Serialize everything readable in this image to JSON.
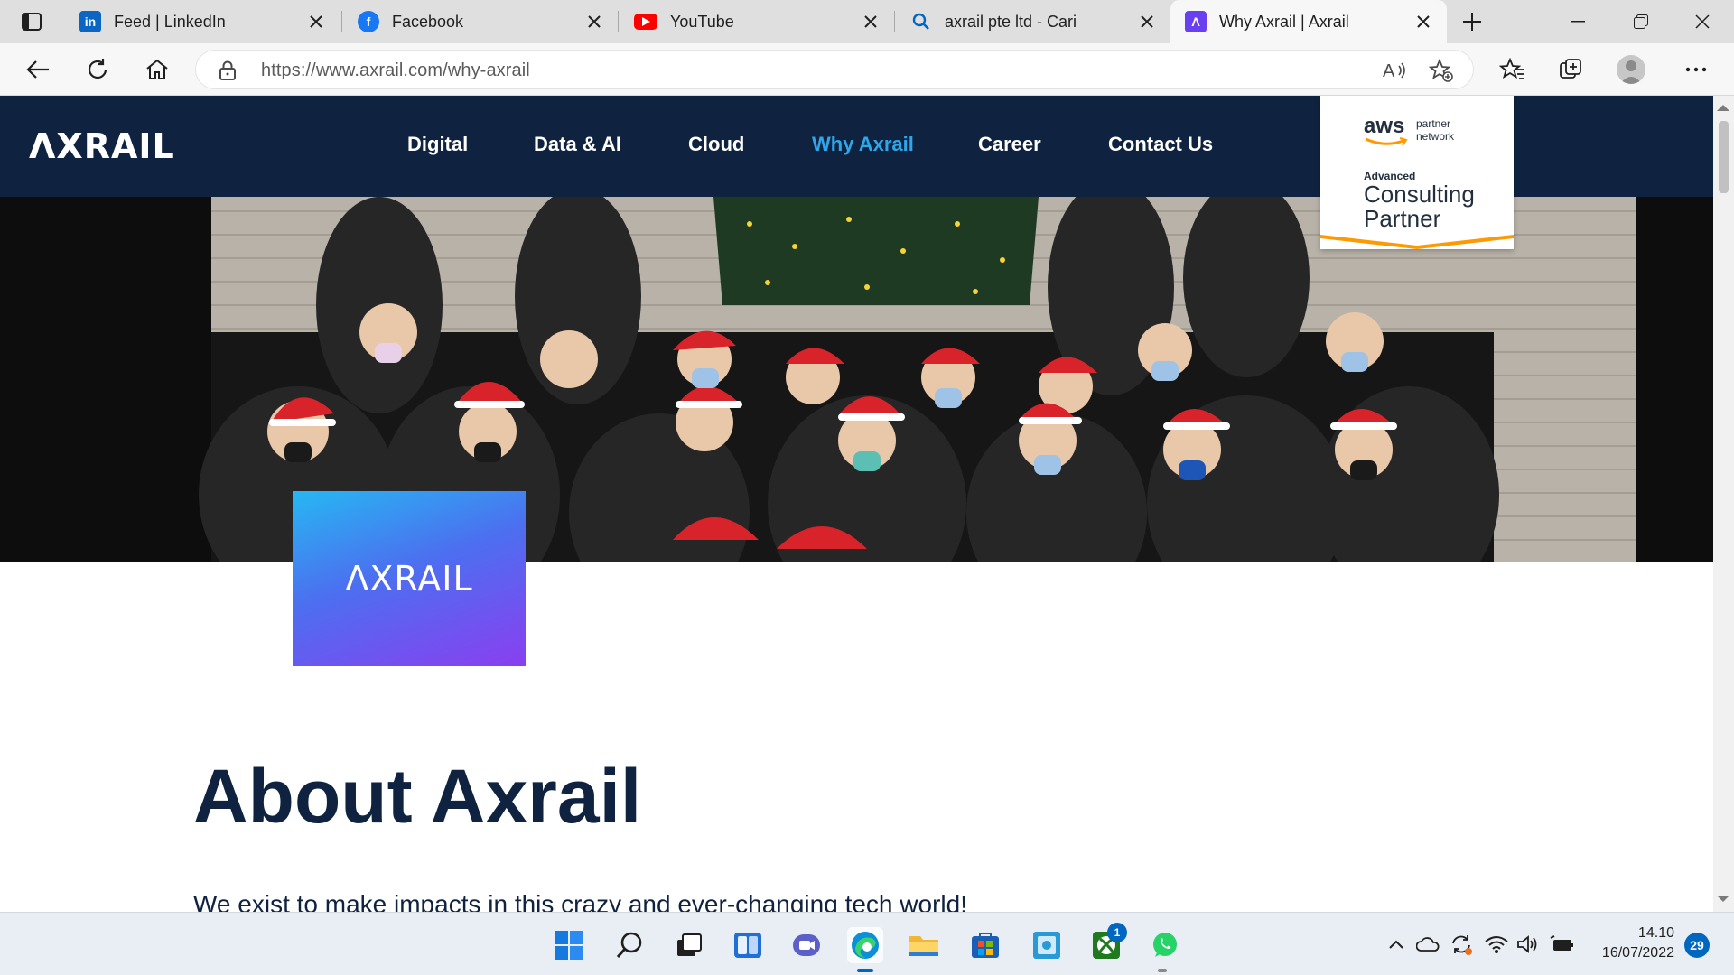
{
  "browser": {
    "tabs": [
      {
        "title": "Feed | LinkedIn",
        "favicon": "linkedin-icon",
        "color": "#0a66c2"
      },
      {
        "title": "Facebook",
        "favicon": "facebook-icon",
        "color": "#1877f2"
      },
      {
        "title": "YouTube",
        "favicon": "youtube-icon",
        "color": "#ff0000"
      },
      {
        "title": "axrail pte ltd - Cari",
        "favicon": "search-icon",
        "color": "#0067c0"
      },
      {
        "title": "Why Axrail | Axrail",
        "favicon": "axrail-icon",
        "color": "#6a3ff0",
        "active": true
      }
    ],
    "url_host": "https://www.axrail.com",
    "url_path": "/why-axrail"
  },
  "site": {
    "logo": "ΛXRAIL",
    "nav": [
      "Digital",
      "Data & AI",
      "Cloud",
      "Why Axrail",
      "Career",
      "Contact Us"
    ],
    "active_nav": "Why Axrail",
    "aws_badge": {
      "logo": "aws",
      "program": "partner network",
      "tier": "Advanced",
      "partner_type": "Consulting Partner"
    },
    "brand_card_logo": "ΛXRAIL",
    "about_title": "About Axrail",
    "about_text": "We exist to make impacts in this crazy and ever-changing tech world!"
  },
  "taskbar": {
    "apps": [
      "start-icon",
      "search-icon",
      "task-view-icon",
      "widgets-icon",
      "chat-icon",
      "edge-icon",
      "file-explorer-icon",
      "store-icon",
      "photo-icon",
      "xbox-icon",
      "whatsapp-icon"
    ],
    "xbox_badge": "1",
    "time": "14.10",
    "date": "16/07/2022",
    "notifications": "29"
  },
  "colors": {
    "nav_bg": "#0f2340",
    "nav_active": "#2ea7ea",
    "brand_gradient_start": "#26b8f2",
    "brand_gradient_end": "#8a3ff0"
  }
}
